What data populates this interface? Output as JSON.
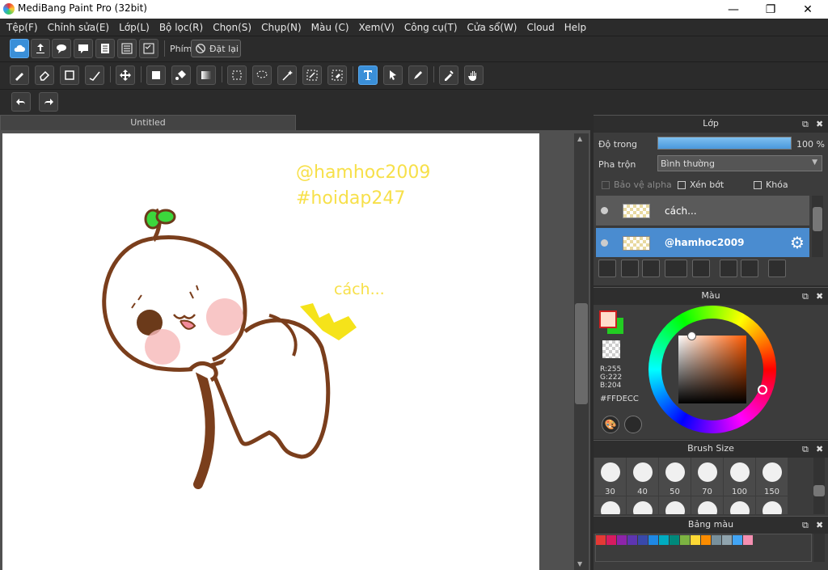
{
  "window": {
    "title": "MediBang Paint Pro (32bit)",
    "min": "—",
    "max": "❐",
    "close": "✕"
  },
  "menu": [
    "Tệp(F)",
    "Chỉnh sửa(E)",
    "Lớp(L)",
    "Bộ lọc(R)",
    "Chọn(S)",
    "Chụp(N)",
    "Màu (C)",
    "Xem(V)",
    "Công cụ(T)",
    "Cửa sổ(W)",
    "Cloud",
    "Help"
  ],
  "toolbar1": {
    "shortcut_label": "Phím",
    "reset_label": "Đặt lại"
  },
  "document": {
    "tab": "Untitled"
  },
  "canvas_text": {
    "handle": "@hamhoc2009",
    "hashtag": "#hoidap247",
    "caption": "cách..."
  },
  "layer_panel": {
    "title": "Lớp",
    "opacity_label": "Độ trong",
    "opacity_value": "100 %",
    "opacity_fraction": 1.0,
    "blend_label": "Pha trộn",
    "blend_value": "Bình thường",
    "protect_alpha": "Bảo vệ alpha",
    "clipping": "Xén bớt",
    "lock": "Khóa",
    "layers": [
      {
        "name": "cách...",
        "selected": false
      },
      {
        "name": "@hamhoc2009",
        "selected": true
      }
    ]
  },
  "color_panel": {
    "title": "Màu",
    "r": "R:255",
    "g": "G:222",
    "b": "B:204",
    "hex": "#FFDECC",
    "fg": "#FFDECC",
    "bg": "#22CC22"
  },
  "brush_panel": {
    "title": "Brush Size",
    "sizes": [
      "30",
      "40",
      "50",
      "70",
      "100",
      "150"
    ]
  },
  "palette_panel": {
    "title": "Bảng màu",
    "colors": [
      "#e53935",
      "#d81b60",
      "#8e24aa",
      "#5e35b1",
      "#3949ab",
      "#1e88e5",
      "#00acc1",
      "#00897b",
      "#7cb342",
      "#fdd835",
      "#fb8c00",
      "#78909c",
      "#90a4ae",
      "#42a5f5",
      "#f48fb1"
    ]
  }
}
